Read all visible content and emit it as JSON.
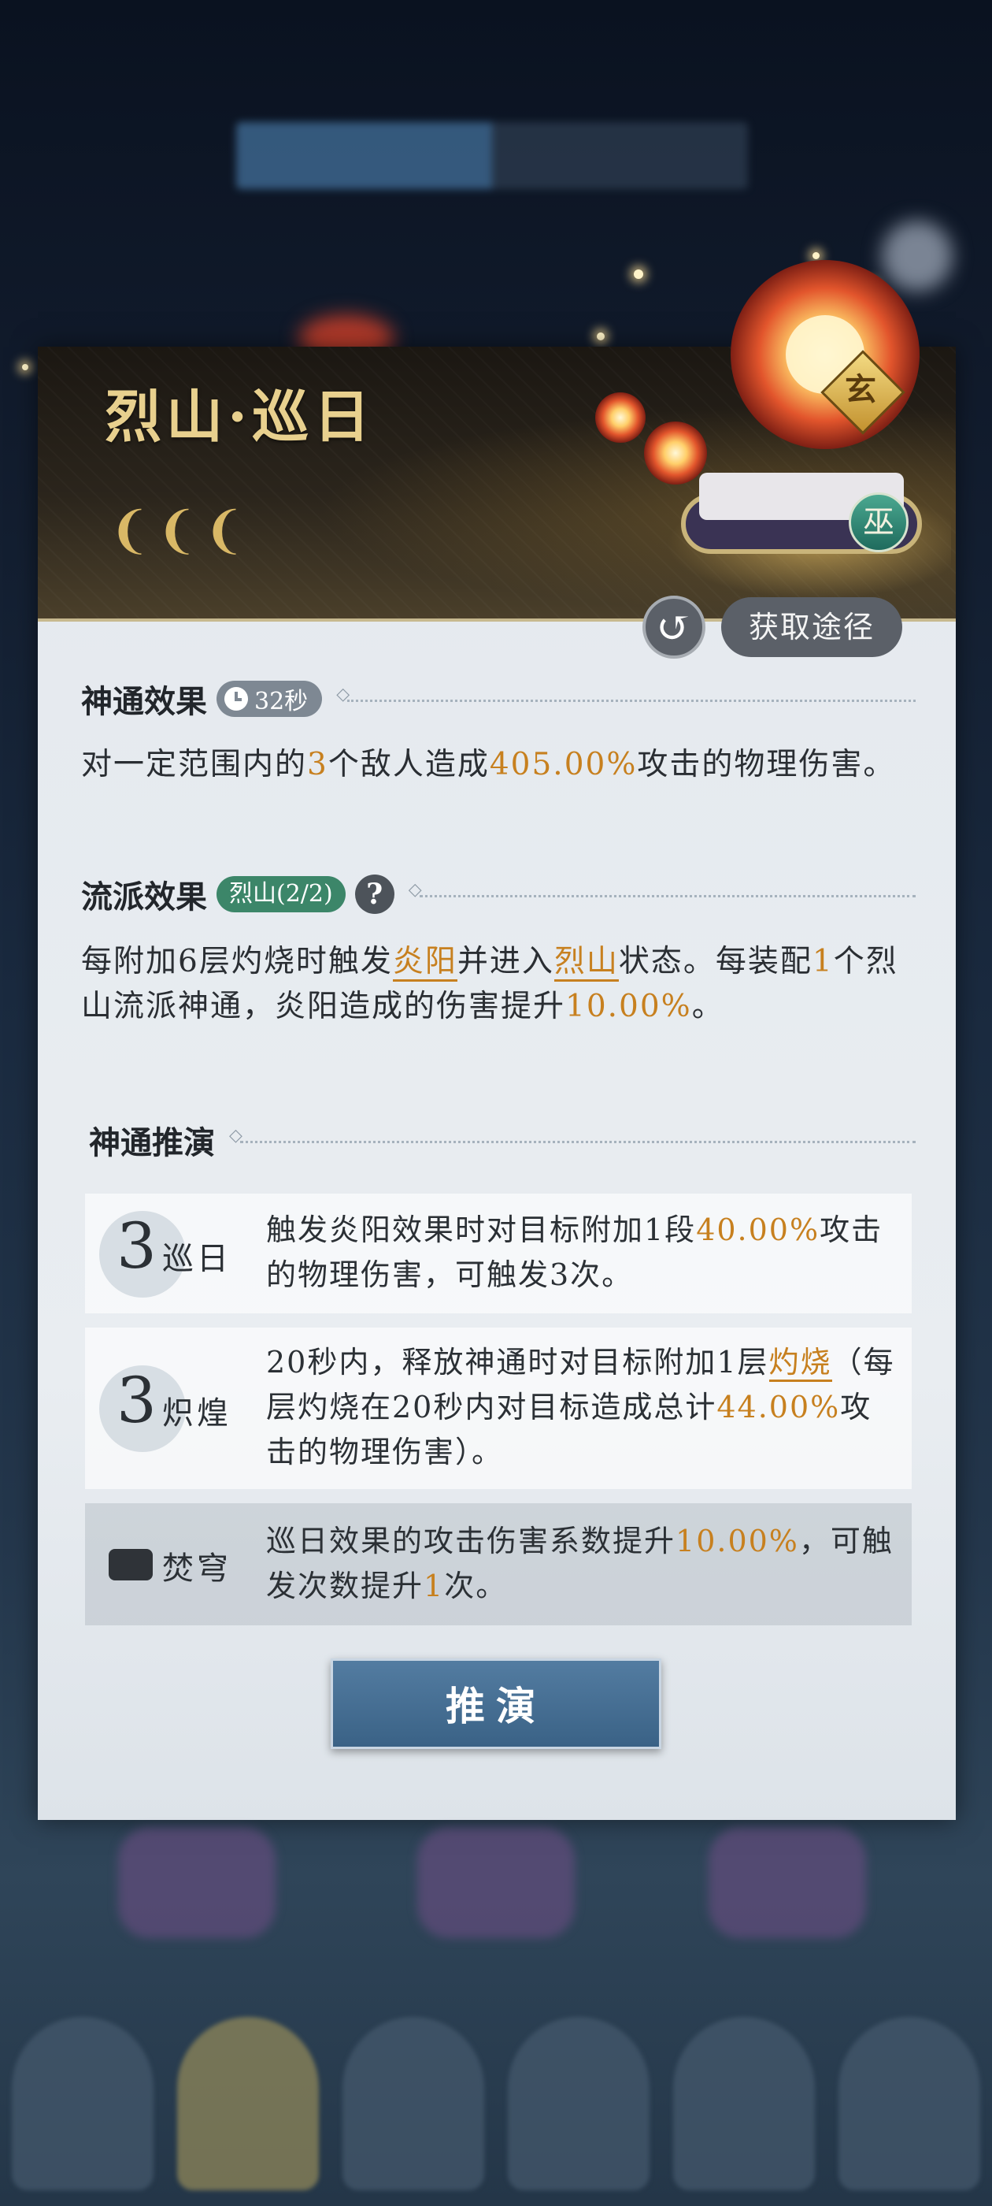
{
  "skill": {
    "title": "烈山·巡日",
    "grade_badge": "玄",
    "class_badge": "巫",
    "mark_glyph": "❨",
    "acquire_label": "获取途径",
    "refresh_glyph": "↺"
  },
  "effect": {
    "heading": "神通效果",
    "cooldown": "32秒",
    "text_parts": [
      "对一定范围内的",
      "3",
      "个敌人造成",
      "405.00%",
      "攻击的物理伤害。"
    ]
  },
  "school": {
    "heading": "流派效果",
    "badge": "烈山(2/2)",
    "help_glyph": "?",
    "text_parts": [
      "每附加6层灼烧时触发",
      "炎阳",
      "并进入",
      "烈山",
      "状态。每装配",
      "1",
      "个烈山流派神通，炎阳造成的伤害提升",
      "10.00%",
      "。"
    ]
  },
  "evolution": {
    "heading": "神通推演",
    "items": [
      {
        "level": "3",
        "name": "巡日",
        "parts": [
          "触发炎阳效果时对目标附加1段",
          "40.00%",
          "攻击的物理伤害，可触发3次。"
        ]
      },
      {
        "level": "3",
        "name": "炽煌",
        "parts": [
          "20秒内，释放神通时对目标附加1层",
          "灼烧",
          "（每层灼烧在20秒内对目标造成总计",
          "44.00%",
          "攻击的物理伤害）。"
        ]
      },
      {
        "level": "",
        "name": "焚穹",
        "parts": [
          "巡日效果的攻击伤害系数提升",
          "10.00%",
          "，可触发次数提升",
          "1",
          "次。"
        ]
      }
    ],
    "button_label": "推演"
  },
  "colors": {
    "accent": "#c7801f",
    "title_gold": "#e8d08e",
    "school_green": "#3c8669",
    "button_blue": "#3a6286"
  }
}
